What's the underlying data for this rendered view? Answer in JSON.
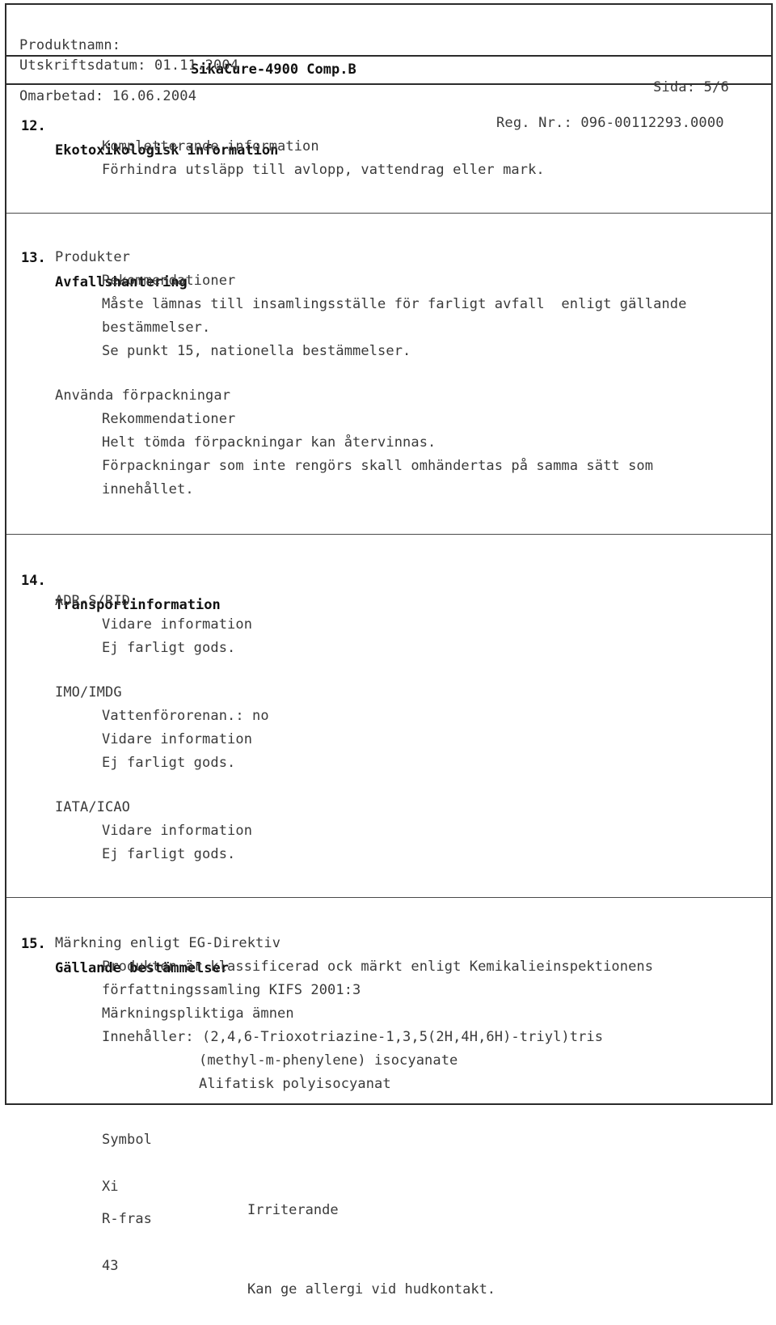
{
  "header": {
    "product_label": "Produktnamn:",
    "product_name": "SikaCure-4900 Comp.B",
    "print_date_line": "Utskriftsdatum: 01.11.2004",
    "page_label": "Sida: 5/6",
    "revised_line": "Omarbetad: 16.06.2004",
    "reg_nr_line": "Reg. Nr.: 096-00112293.0000"
  },
  "sections": [
    {
      "number": "12.",
      "title": "Ekotoxikologisk information",
      "lines": [
        "Kompletterande information",
        "Förhindra utsläpp till avlopp, vattendrag eller mark."
      ]
    },
    {
      "number": "13.",
      "title": "Avfallshantering",
      "sub1": "Produkter",
      "sub1_head": "Rekommendationer",
      "sub1_lines": [
        "Måste lämnas till insamlingsställe för farligt avfall  enligt gällande",
        "bestämmelser.",
        "Se punkt 15, nationella bestämmelser."
      ],
      "sub2": "Använda förpackningar",
      "sub2_head": "Rekommendationer",
      "sub2_lines": [
        "Helt tömda förpackningar kan återvinnas.",
        "Förpackningar som inte rengörs skall omhändertas på samma sätt som",
        "innehållet."
      ]
    },
    {
      "number": "14.",
      "title": "Transportinformation",
      "groups": [
        {
          "name": "ADR-S/RID",
          "lines": [
            "Vidare information",
            "Ej farligt gods."
          ]
        },
        {
          "name": "IMO/IMDG",
          "lines": [
            "Vattenförorenan.: no",
            "Vidare information",
            "Ej farligt gods."
          ]
        },
        {
          "name": "IATA/ICAO",
          "lines": [
            "Vidare information",
            "Ej farligt gods."
          ]
        }
      ]
    },
    {
      "number": "15.",
      "title": "Gällande bestämmelser",
      "label_heading": "Märkning enligt EG-Direktiv",
      "label_lines": [
        "Produkten är klassificerad ock märkt enligt Kemikalieinspektionens",
        "författningssamling KIFS 2001:3",
        "Märkningspliktiga ämnen",
        "Innehåller: (2,4,6-Trioxotriazine-1,3,5(2H,4H,6H)-triyl)tris"
      ],
      "chem_lines": [
        "(methyl-m-phenylene) isocyanate",
        "Alifatisk polyisocyanat"
      ],
      "symbol_heading": "Symbol",
      "symbol_code": "Xi",
      "symbol_text": "Irriterande",
      "rphrase_heading": "R-fras",
      "rphrase_code": "43",
      "rphrase_text": "Kan ge allergi vid hudkontakt."
    }
  ]
}
